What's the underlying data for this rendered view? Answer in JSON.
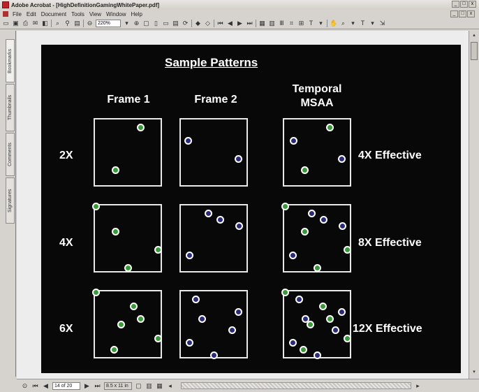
{
  "window": {
    "title": "Adobe Acrobat - [HighDefinitionGamingWhitePaper.pdf]",
    "controls": [
      "_",
      "□",
      "x"
    ]
  },
  "menubar": {
    "items": [
      "File",
      "Edit",
      "Document",
      "Tools",
      "View",
      "Window",
      "Help"
    ]
  },
  "toolbar": {
    "zoom_value": "220%"
  },
  "side_tabs": [
    "Bookmarks",
    "Thumbnails",
    "Comments",
    "Signatures"
  ],
  "status_bar": {
    "page_value": "14 of 20",
    "page_size": "8.5 x 11 in"
  },
  "slide": {
    "heading": "Sample Patterns",
    "columns": [
      "Frame 1",
      "Frame 2",
      "Temporal MSAA"
    ],
    "rows": [
      {
        "label": "2X",
        "effective": "4X Effective"
      },
      {
        "label": "4X",
        "effective": "8X Effective"
      },
      {
        "label": "6X",
        "effective": "12X Effective"
      }
    ]
  },
  "colors": {
    "slide_background": "#080808",
    "sample_blue": "#2a2c7a",
    "sample_green": "#3a9a3a",
    "box_border": "#e8e8e8"
  }
}
